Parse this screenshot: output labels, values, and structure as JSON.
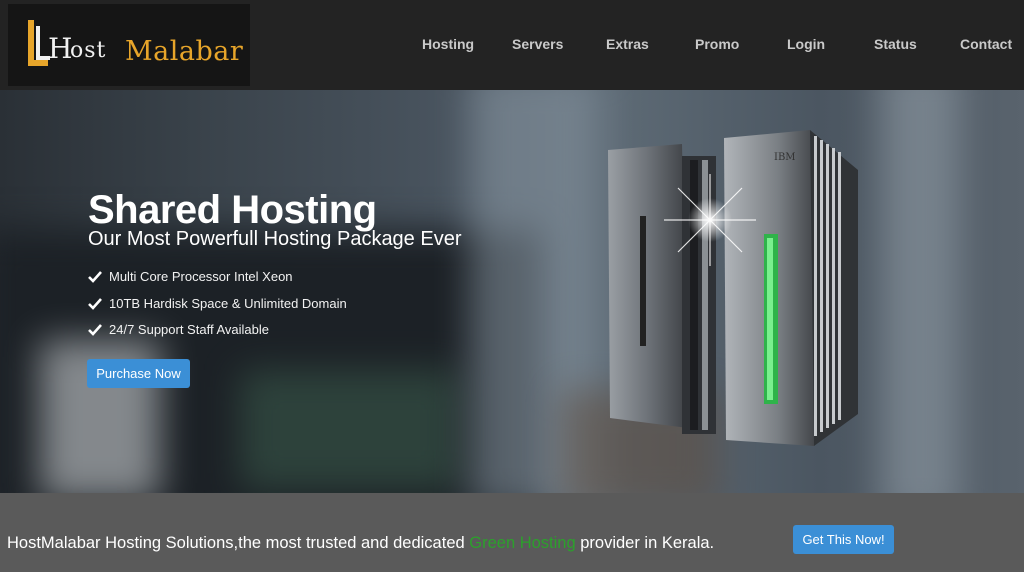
{
  "brand": {
    "logo_h": "H",
    "logo_ost": "ost",
    "logo_malabar": "Malabar",
    "accent_color": "#e7a52a"
  },
  "nav": {
    "items": [
      "Hosting",
      "Servers",
      "Extras",
      "Promo",
      "Login",
      "Status",
      "Contact"
    ]
  },
  "hero": {
    "title_bold": "Shared",
    "title_rest": " Hosting",
    "subtitle": "Our Most Powerfull Hosting Package Ever",
    "features": [
      "Multi Core Processor Intel Xeon",
      "10TB Hardisk Space & Unlimited Domain",
      "24/7 Support Staff Available"
    ],
    "cta": "Purchase Now",
    "server_brand": "IBM"
  },
  "bottom": {
    "tagline_before": "HostMalabar Hosting Solutions,the most trusted and dedicated ",
    "tagline_green": "Green Hosting",
    "tagline_after": " provider in Kerala.",
    "cta": "Get This Now!",
    "button_color": "#3b8fd6"
  }
}
